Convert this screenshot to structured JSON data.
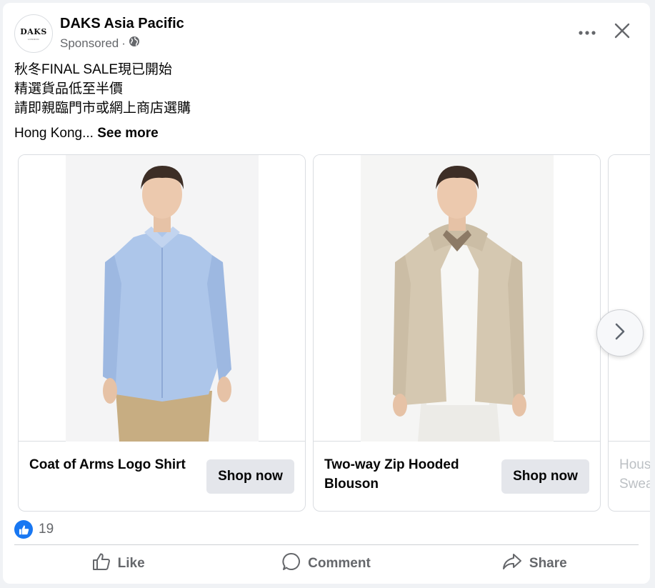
{
  "header": {
    "avatar_text": "DAKS",
    "avatar_subtext": "LONDON",
    "page_name": "DAKS Asia Pacific",
    "sponsored_label": "Sponsored",
    "separator": " ·"
  },
  "caption": {
    "lines": [
      "秋冬FINAL SALE現已開始",
      "精選貨品低至半價",
      "請即親臨門市或網上商店選購"
    ],
    "truncated_text": "Hong Kong...",
    "see_more_label": "See more"
  },
  "carousel": {
    "cards": [
      {
        "title": "Coat of Arms Logo Shirt",
        "cta_label": "Shop now"
      },
      {
        "title": "Two-way Zip Hooded Blouson",
        "cta_label": "Shop now"
      },
      {
        "title": "Hous Swea",
        "title_line1": "Hous",
        "title_line2": "Swea"
      }
    ],
    "next_icon": "chevron-right-icon"
  },
  "reactions": {
    "count": "19",
    "icon": "thumbs-up-icon",
    "accent": "#1877f2"
  },
  "actions": {
    "like_label": "Like",
    "comment_label": "Comment",
    "share_label": "Share"
  },
  "colors": {
    "secondary_text": "#65676b",
    "button_bg": "#e4e6eb",
    "border": "#dadde1"
  }
}
